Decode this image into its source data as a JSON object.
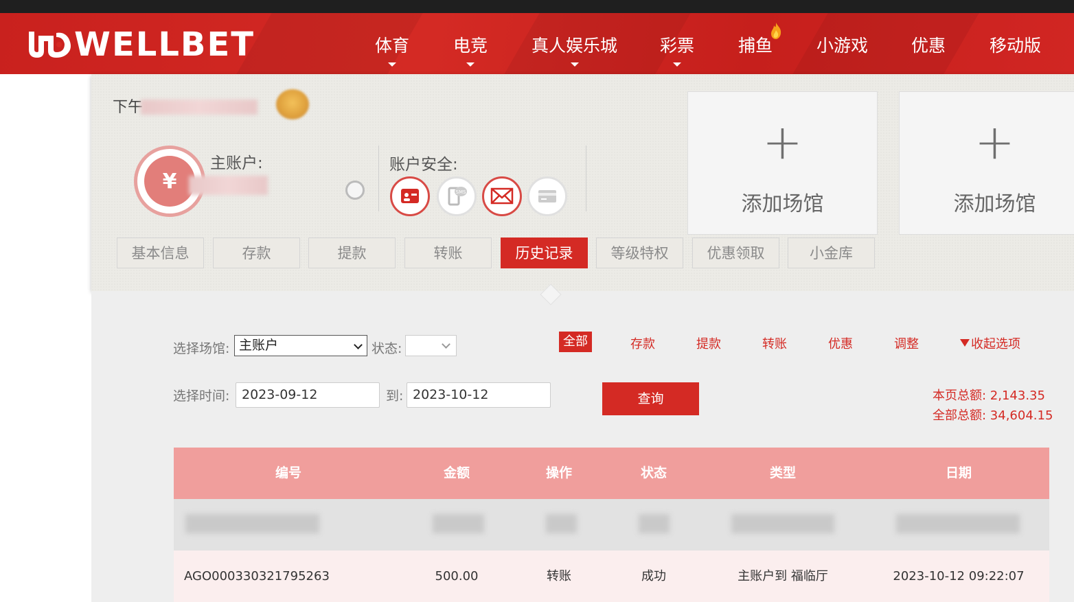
{
  "brand": {
    "name": "WELLBET"
  },
  "nav": [
    {
      "label": "体育",
      "dropdown": true
    },
    {
      "label": "电竞",
      "dropdown": true
    },
    {
      "label": "真人娱乐城",
      "dropdown": true
    },
    {
      "label": "彩票",
      "dropdown": true
    },
    {
      "label": "捕鱼",
      "dropdown": false
    },
    {
      "label": "小游戏",
      "dropdown": false
    },
    {
      "label": "优惠",
      "dropdown": false
    },
    {
      "label": "移动版",
      "dropdown": false
    }
  ],
  "account": {
    "greeting_prefix": "下午",
    "main_account_label": "主账户:",
    "security_label": "账户安全:"
  },
  "venues": [
    {
      "plus": "+",
      "label": "添加场馆"
    },
    {
      "plus": "+",
      "label": "添加场馆"
    }
  ],
  "tabs": [
    "基本信息",
    "存款",
    "提款",
    "转账",
    "历史记录",
    "等级特权",
    "优惠领取",
    "小金库"
  ],
  "active_tab": "历史记录",
  "filters": {
    "venue_label": "选择场馆:",
    "venue_value": "主账户",
    "status_label": "状态:",
    "types": [
      "全部",
      "存款",
      "提款",
      "转账",
      "优惠",
      "调整"
    ],
    "active_type": "全部",
    "collapse_label": "收起选项",
    "time_label": "选择时间:",
    "from_date": "2023-09-12",
    "to_label": "到:",
    "to_date": "2023-10-12",
    "query_label": "查询"
  },
  "totals": {
    "page_total": "本页总额: 2,143.35",
    "all_total": "全部总额: 34,604.15"
  },
  "table": {
    "headers": [
      "编号",
      "金额",
      "操作",
      "状态",
      "类型",
      "日期"
    ],
    "rows": [
      {
        "id": "AGO000330321795263",
        "amount": "500.00",
        "operation": "转账",
        "status": "成功",
        "type": "主账户到 福临厅",
        "date": "2023-10-12 09:22:07"
      }
    ]
  },
  "colors": {
    "brand_red": "#d42a24",
    "table_header": "#f09e9c",
    "row_bg": "#fbeeee"
  }
}
